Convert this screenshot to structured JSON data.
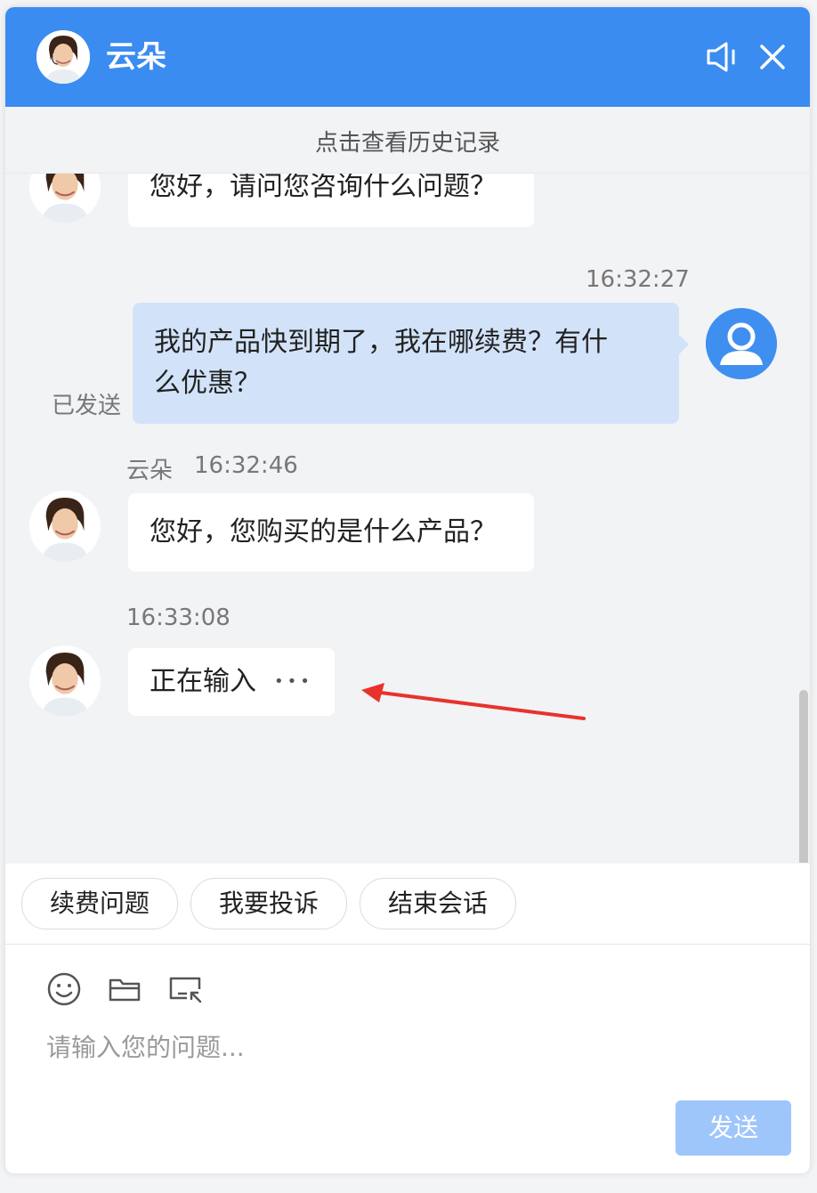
{
  "header": {
    "title": "云朵",
    "speaker_icon": "speaker-icon",
    "close_icon": "close-icon",
    "bg_color": "#3b8cf1"
  },
  "history": {
    "label": "点击查看历史记录"
  },
  "messages": [
    {
      "from": "agent",
      "text": "您好，请问您咨询什么问题？"
    },
    {
      "from": "user",
      "time": "16:32:27",
      "line1": "我的产品快到期了，我在哪续费？有什",
      "line2": "么优惠？",
      "status": "已发送"
    },
    {
      "from": "agent",
      "name": "云朵",
      "time": "16:32:46",
      "text": "您好，您购买的是什么产品？"
    },
    {
      "from": "agent",
      "time": "16:33:08",
      "text": "正在输入",
      "dots": "•••"
    }
  ],
  "quick_replies": [
    "续费问题",
    "我要投诉",
    "结束会话"
  ],
  "input": {
    "placeholder": "请输入您的问题...",
    "send_label": "发送",
    "emoji_icon": "emoji-icon",
    "folder_icon": "folder-icon",
    "screenshot_icon": "screenshot-icon"
  }
}
